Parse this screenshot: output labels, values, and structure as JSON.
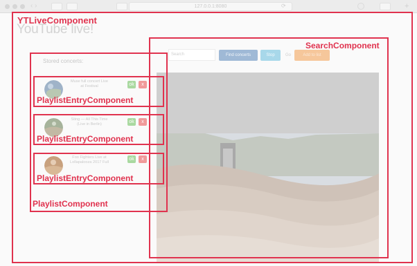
{
  "browser": {
    "url": "127.0.0.1:8080"
  },
  "app": {
    "title": "YouTube live!"
  },
  "playlist": {
    "heading": "Stored concerts:",
    "entries": [
      {
        "title": "Muse full concert Live at Festival",
        "ok": "ok",
        "del": "x"
      },
      {
        "title": "Sting — All This Time (Live in Berlin)",
        "ok": "ok",
        "del": "x"
      },
      {
        "title": "Foo Fighters Live at Lollapalooza 2017 Full",
        "ok": "ok",
        "del": "x"
      }
    ]
  },
  "search": {
    "placeholder": "Search",
    "buttons": {
      "playlist": "Find concerts",
      "stop": "Stop",
      "go": "Go",
      "orange": "Add to list"
    }
  },
  "annotations": {
    "yt_live": "YTLiveComponent",
    "search": "SearchComponent",
    "playlist": "PlaylistComponent",
    "entry_1": "PlaylistEntryComponent",
    "entry_2": "PlaylistEntryComponent",
    "entry_3": "PlaylistEntryComponent"
  },
  "colors": {
    "annotation": "#e0324e",
    "button_blue": "#9fb9d6",
    "button_cyan": "#a8d8ea",
    "button_orange": "#f6c79b",
    "button_green": "#a9d9a0",
    "button_red": "#f09a9a"
  }
}
